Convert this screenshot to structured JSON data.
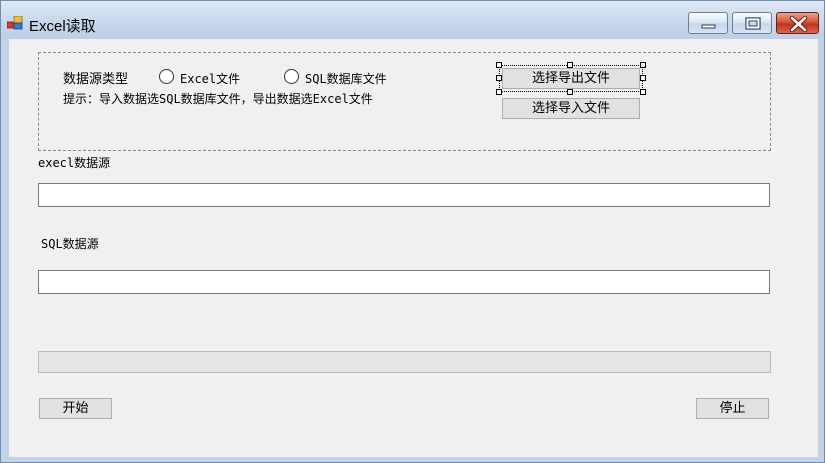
{
  "window": {
    "title": "Excel读取"
  },
  "datasource": {
    "type_label": "数据源类型",
    "option_excel": "Excel文件",
    "option_sql": "SQL数据库文件",
    "hint": "提示：导入数据选SQL数据库文件，导出数据选Excel文件",
    "select_export_button": "选择导出文件",
    "select_import_button": "选择导入文件"
  },
  "excel_section": {
    "label": "execl数据源",
    "value": ""
  },
  "sql_section": {
    "label": "SQL数据源",
    "value": ""
  },
  "progress": {
    "value": 0
  },
  "actions": {
    "start_button": "开始",
    "stop_button": "停止"
  }
}
